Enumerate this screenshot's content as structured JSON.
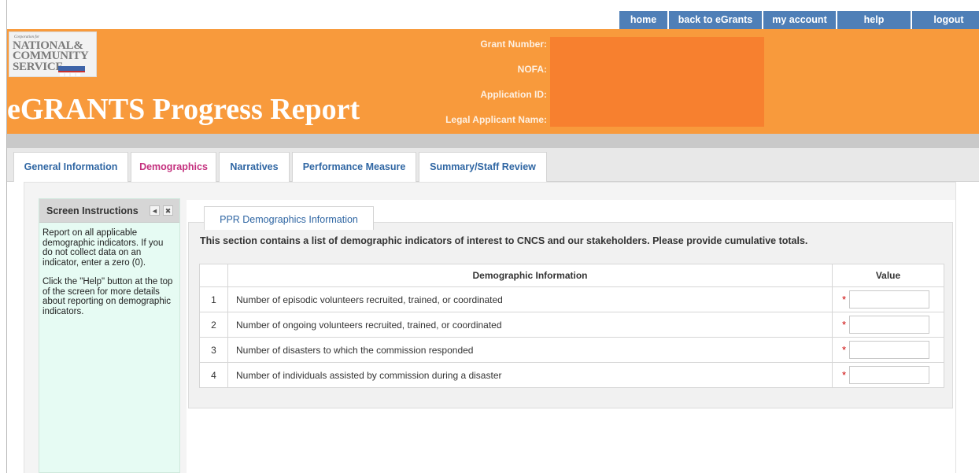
{
  "nav": {
    "links": [
      "home",
      "back to eGrants",
      "my account",
      "help",
      "logout"
    ]
  },
  "header": {
    "logo": {
      "corp": "Corporation for",
      "line1": "NATIONAL&",
      "line2": "COMMUNITY",
      "line3": "SERVICE"
    },
    "app_title": "eGRANTS Progress Report",
    "fields": {
      "grant_number_label": "Grant Number:",
      "nofa_label": "NOFA:",
      "application_id_label": "Application ID:",
      "legal_applicant_label": "Legal Applicant Name:"
    }
  },
  "tabs": [
    {
      "label": "General Information",
      "active": false
    },
    {
      "label": "Demographics",
      "active": true
    },
    {
      "label": "Narratives",
      "active": false
    },
    {
      "label": "Performance Measure",
      "active": false
    },
    {
      "label": "Summary/Staff Review",
      "active": false
    }
  ],
  "instructions": {
    "title": "Screen Instructions",
    "collapse_glyph": "◄",
    "close_glyph": "✖",
    "paragraph1": "Report on all applicable demographic indicators.  If you do not collect data on an indicator, enter a zero (0).",
    "paragraph2": "Click the \"Help\" button at the top of the screen for more details about reporting on demographic indicators."
  },
  "section": {
    "tab_label": "PPR Demographics Information",
    "description": "This section contains a list of demographic indicators of interest to CNCS and our stakeholders. Please provide cumulative totals.",
    "table": {
      "header_num": "",
      "header_info": "Demographic Information",
      "header_value": "Value",
      "required_marker": "*",
      "rows": [
        {
          "num": "1",
          "label": "Number of episodic volunteers recruited, trained, or coordinated",
          "value": ""
        },
        {
          "num": "2",
          "label": "Number of ongoing volunteers recruited, trained, or coordinated",
          "value": ""
        },
        {
          "num": "3",
          "label": "Number of disasters to which the commission responded",
          "value": ""
        },
        {
          "num": "4",
          "label": "Number of individuals assisted by commission during a disaster",
          "value": ""
        }
      ]
    }
  },
  "colors": {
    "header_orange": "#f89a3c",
    "nav_blue": "#4f7fb7",
    "tab_blue": "#2f66a3",
    "active_tab_magenta": "#c4307e",
    "required_red": "#cc0000",
    "instructions_bg": "#e6fbf3"
  }
}
